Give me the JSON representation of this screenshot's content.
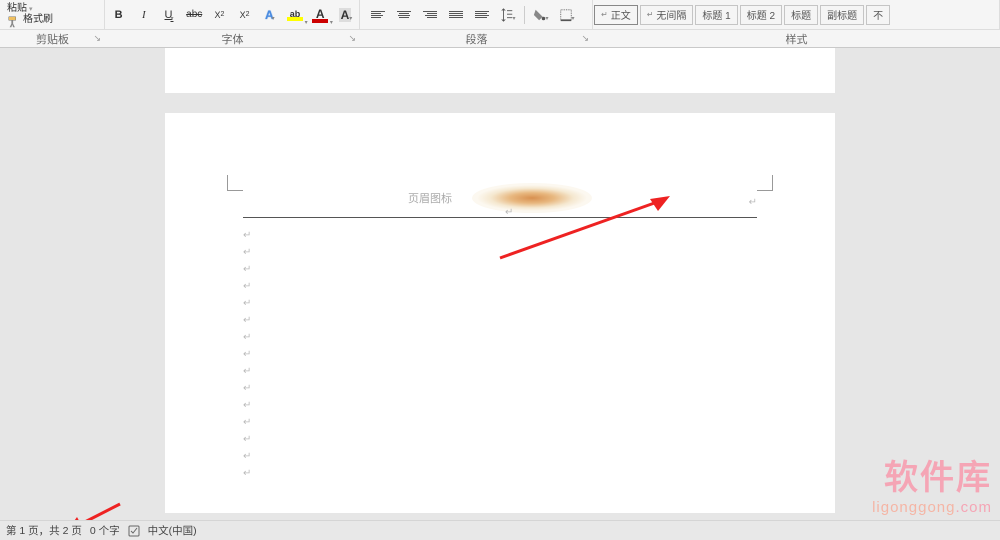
{
  "ribbon": {
    "clipboard": {
      "paste": "粘贴",
      "format_painter": "格式刷",
      "label": "剪贴板"
    },
    "font": {
      "bold": "B",
      "italic": "I",
      "underline": "U",
      "strike": "abc",
      "sub": "X",
      "sup": "X",
      "text_effects": "A",
      "highlight": "A",
      "font_color": "A",
      "clear_format": "A",
      "highlight_color": "#ffff00",
      "font_color_value": "#cc0000",
      "label": "字体"
    },
    "paragraph": {
      "label": "段落"
    },
    "styles": {
      "label": "样式",
      "items": [
        {
          "tick": "↵",
          "name": "正文"
        },
        {
          "tick": "↵",
          "name": "无间隔"
        },
        {
          "tick": "",
          "name": "标题 1"
        },
        {
          "tick": "",
          "name": "标题 2"
        },
        {
          "tick": "",
          "name": "标题"
        },
        {
          "tick": "",
          "name": "副标题"
        },
        {
          "tick": "",
          "name": "不"
        }
      ]
    }
  },
  "document": {
    "header_label": "页眉图标",
    "para_mark": "↵"
  },
  "status": {
    "page": "第 1 页，共 2 页",
    "words": "0 个字",
    "language": "中文(中国)"
  },
  "watermark": {
    "line1": "软件库",
    "line2a": "ligonggong",
    "line2b": ".com"
  }
}
